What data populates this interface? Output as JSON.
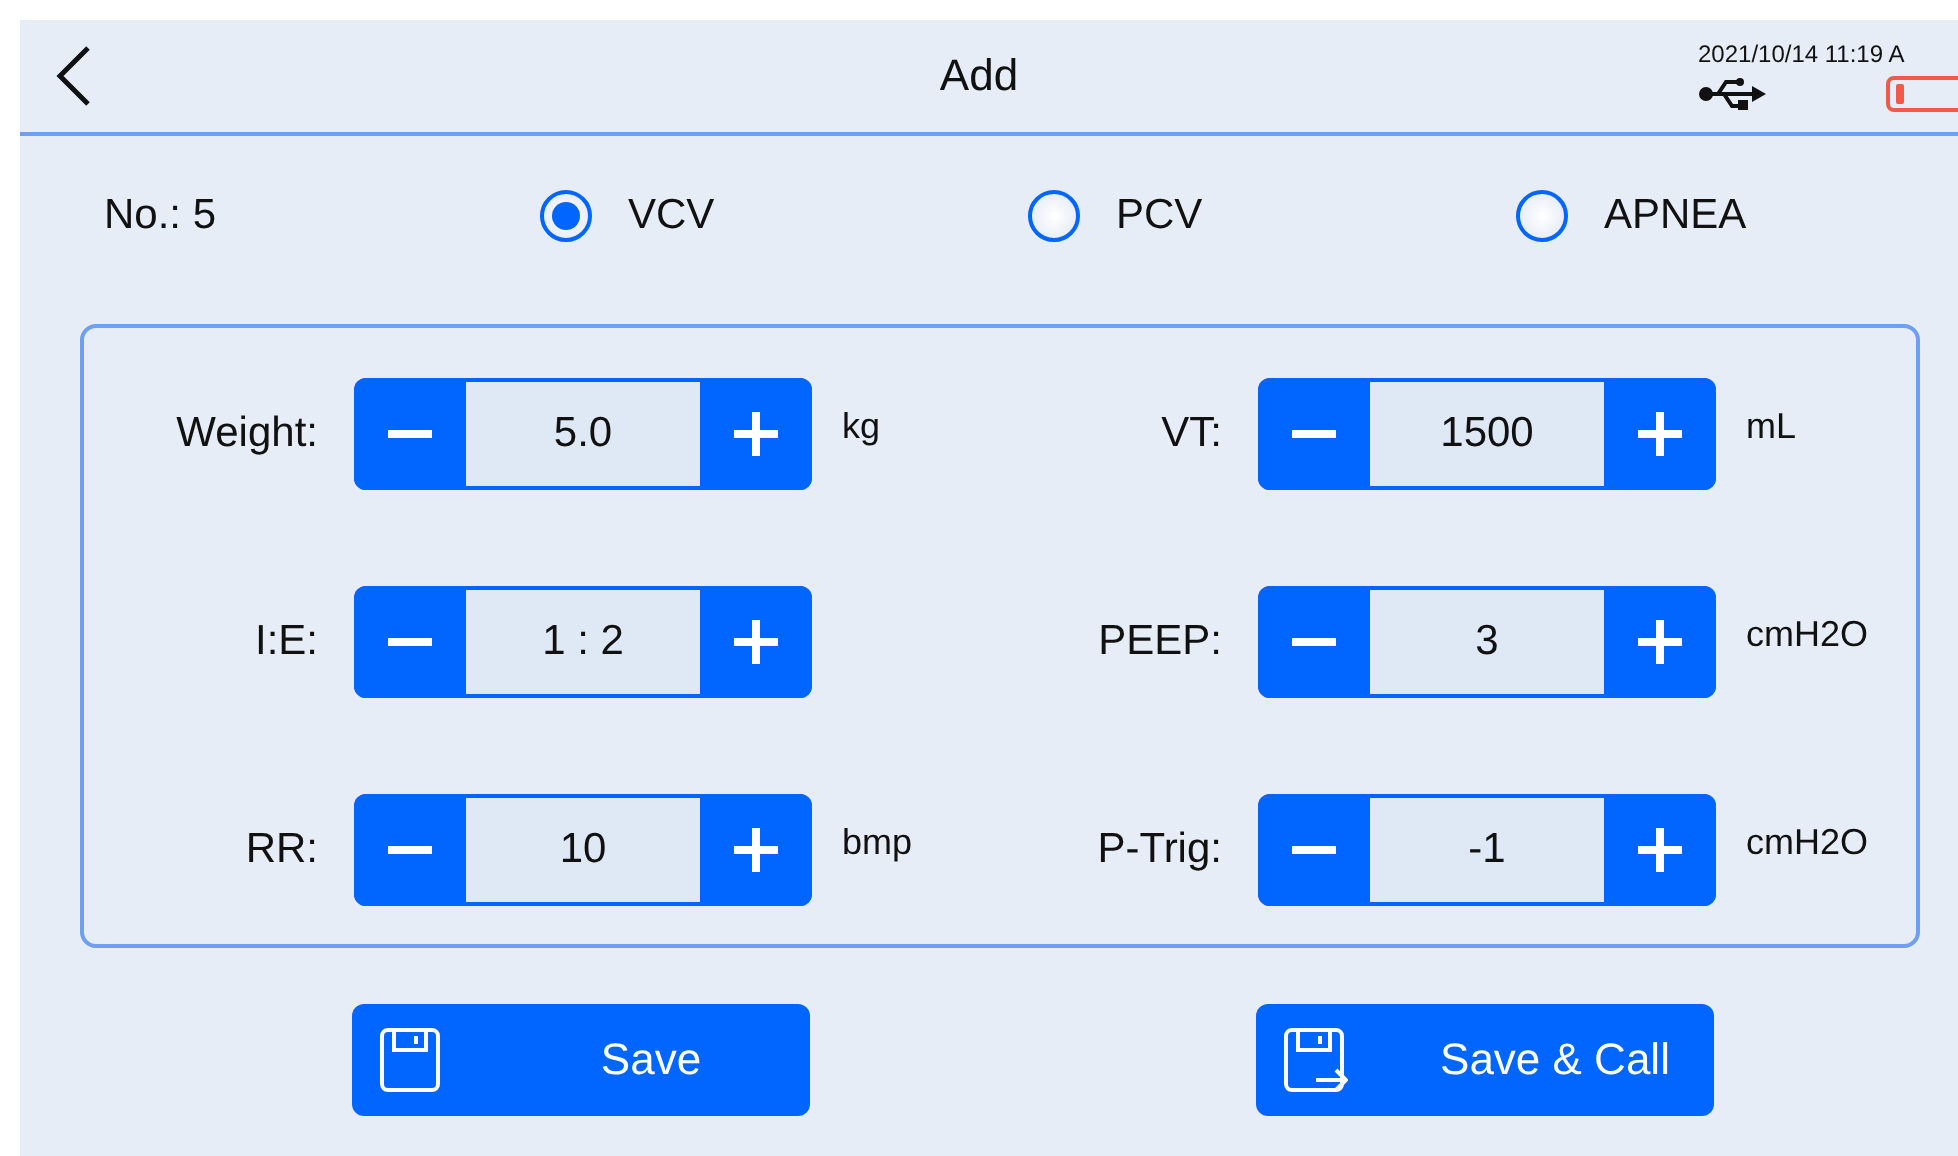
{
  "header": {
    "title": "Add",
    "datetime": "2021/10/14 11:19 A"
  },
  "record": {
    "label": "No.: 5"
  },
  "modes": [
    {
      "label": "VCV",
      "selected": true
    },
    {
      "label": "PCV",
      "selected": false
    },
    {
      "label": "APNEA",
      "selected": false
    }
  ],
  "params": [
    {
      "label": "Weight:",
      "value": "5.0",
      "unit": "kg"
    },
    {
      "label": "VT:",
      "value": "1500",
      "unit": "mL"
    },
    {
      "label": "I:E:",
      "value": "1 : 2"
    },
    {
      "label": "PEEP:",
      "value": "3",
      "unit": "cmH2O"
    },
    {
      "label": "RR:",
      "value": "10",
      "unit": "bmp"
    },
    {
      "label": "P-Trig:",
      "value": "-1",
      "unit": "cmH2O"
    }
  ],
  "actions": [
    {
      "label": "Save",
      "kind": "save"
    },
    {
      "label": "Save & Call",
      "kind": "save-call"
    }
  ]
}
